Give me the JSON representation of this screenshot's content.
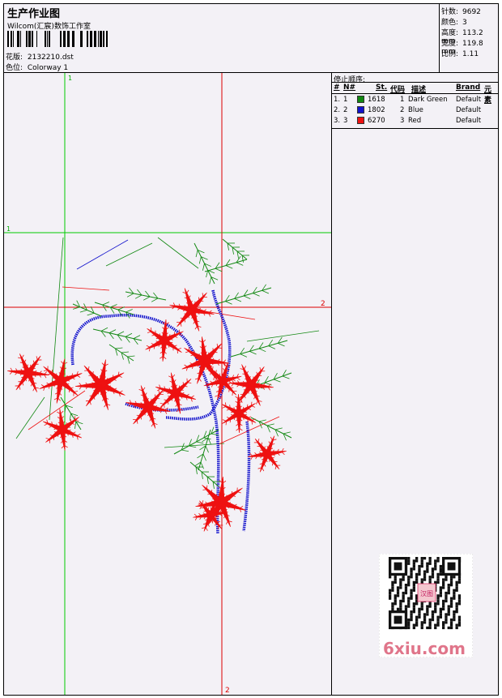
{
  "header": {
    "title": "生产作业图",
    "company": "Wilcom(汇宸)数饰工作室",
    "design_label": "花版:",
    "design_value": "2132210.dst",
    "colorway_label": "色位:",
    "colorway_value": "Colorway 1"
  },
  "stats": {
    "stitches_label": "针数:",
    "stitches_value": "9692",
    "colors_label": "颜色:",
    "colors_value": "3",
    "height_label": "高度:",
    "height_value": "113.2 mm",
    "width_label": "宽度:",
    "width_value": "119.8 mm",
    "scale_label": "比例:",
    "scale_value": "1.11"
  },
  "guides": {
    "v1_label": "1",
    "h1_label": "1",
    "h2_label": "2",
    "v2_label": "2",
    "green_color": "#00cc00",
    "red_color": "#dd0000"
  },
  "stop_sequence": {
    "title": "停止顺序:",
    "headers": [
      "#",
      "N#",
      "St.",
      "代码",
      "描述",
      "Brand",
      "元素"
    ],
    "rows": [
      {
        "index": "1.",
        "n": "1",
        "stitches": "1618",
        "code": "1",
        "description": "Dark Green",
        "brand": "Default",
        "color": "#118811"
      },
      {
        "index": "2.",
        "n": "2",
        "stitches": "1802",
        "code": "2",
        "description": "Blue",
        "brand": "Default",
        "color": "#1111cc"
      },
      {
        "index": "3.",
        "n": "3",
        "stitches": "6270",
        "code": "3",
        "description": "Red",
        "brand": "Default",
        "color": "#ee1111"
      }
    ]
  },
  "watermark": {
    "text": "6xiu.com",
    "stamp": "汉图"
  },
  "colors": {
    "green": "#118811",
    "blue": "#1111cc",
    "red": "#ee1111"
  }
}
